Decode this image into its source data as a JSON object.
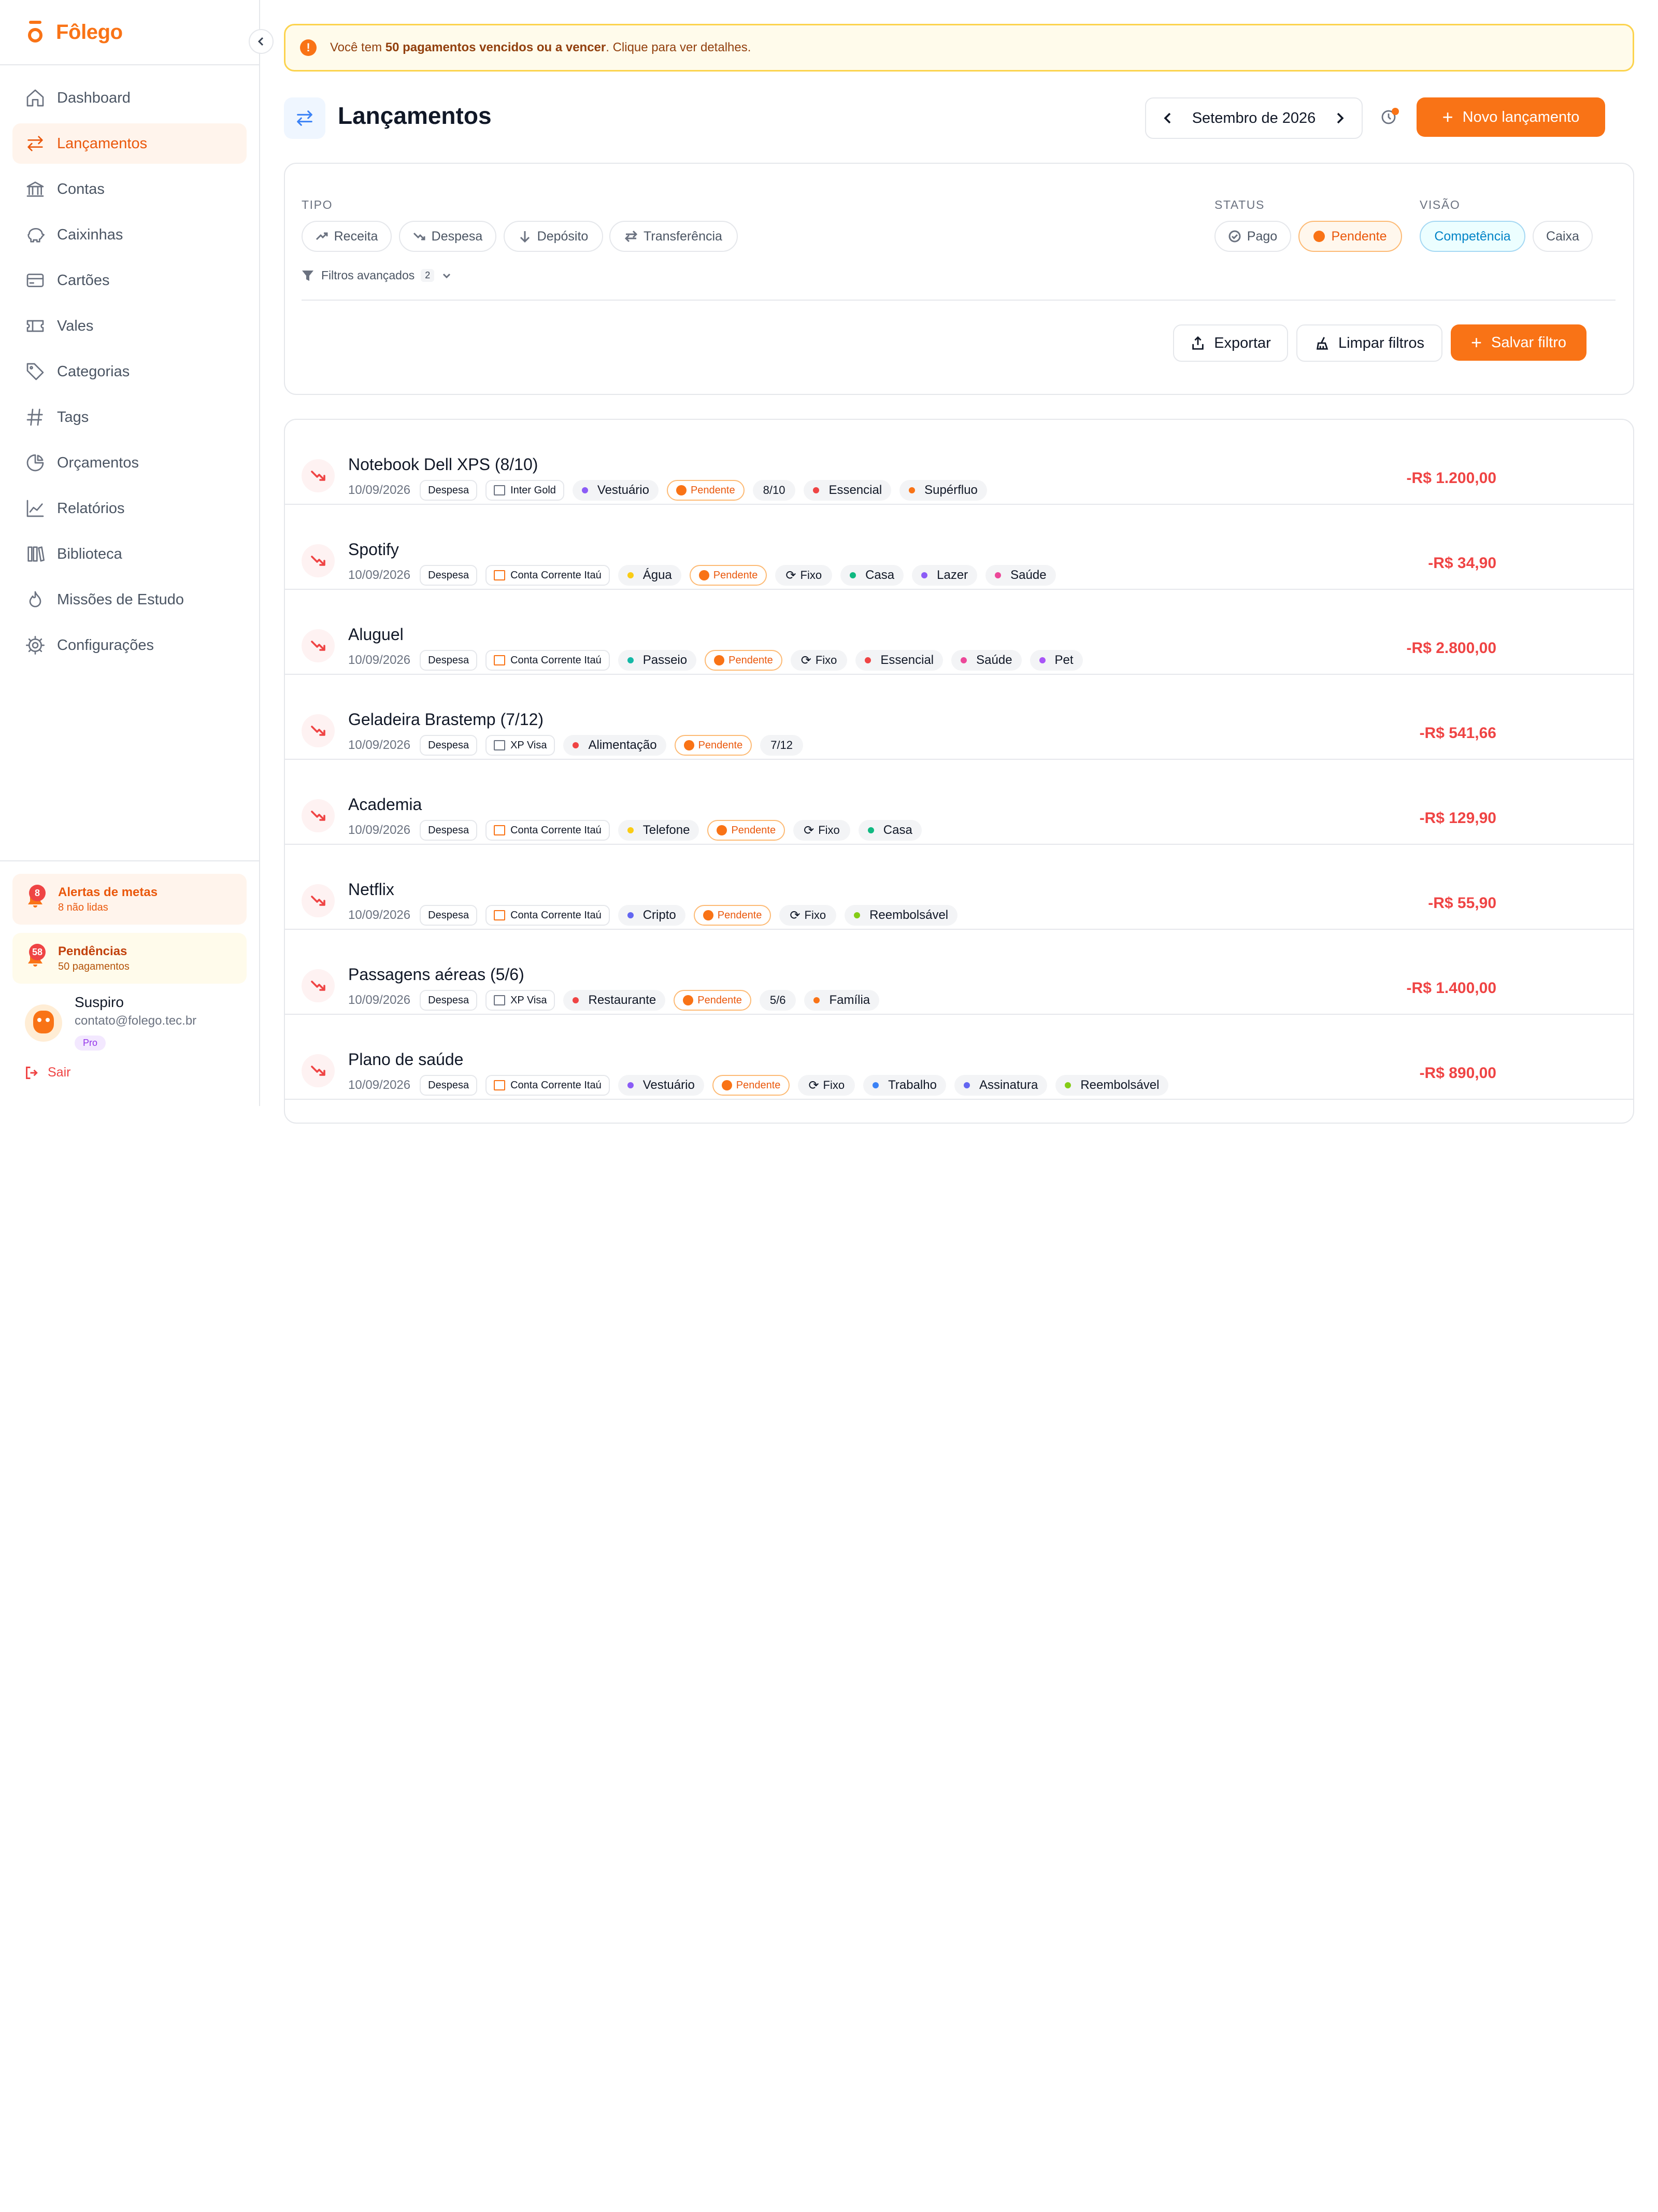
{
  "app": {
    "name": "Fôlego"
  },
  "sidebar": {
    "items": [
      {
        "label": "Dashboard",
        "icon": "home-icon"
      },
      {
        "label": "Lançamentos",
        "icon": "transfer-icon",
        "active": true
      },
      {
        "label": "Contas",
        "icon": "bank-icon"
      },
      {
        "label": "Caixinhas",
        "icon": "piggy-bank-icon"
      },
      {
        "label": "Cartões",
        "icon": "credit-card-icon"
      },
      {
        "label": "Vales",
        "icon": "ticket-icon"
      },
      {
        "label": "Categorias",
        "icon": "tag-icon"
      },
      {
        "label": "Tags",
        "icon": "hash-icon"
      },
      {
        "label": "Orçamentos",
        "icon": "pie-chart-icon"
      },
      {
        "label": "Relatórios",
        "icon": "line-chart-icon"
      },
      {
        "label": "Biblioteca",
        "icon": "library-icon"
      },
      {
        "label": "Missões de Estudo",
        "icon": "flame-icon"
      },
      {
        "label": "Configurações",
        "icon": "gear-icon"
      }
    ],
    "alerts": {
      "metas": {
        "title": "Alertas de metas",
        "sub": "8 não lidas",
        "count": "8"
      },
      "pendencias": {
        "title": "Pendências",
        "sub": "50 pagamentos",
        "count": "58"
      }
    },
    "user": {
      "name": "Suspiro",
      "email": "contato@folego.tec.br",
      "plan": "Pro"
    },
    "logout": "Sair"
  },
  "banner": {
    "prefix": "Você tem ",
    "bold": "50 pagamentos vencidos ou a vencer",
    "suffix": ". Clique para ver detalhes."
  },
  "header": {
    "title": "Lançamentos",
    "month": "Setembro de 2026",
    "new_button": "Novo lançamento"
  },
  "filters": {
    "tipo_label": "TIPO",
    "tipo": [
      "Receita",
      "Despesa",
      "Depósito",
      "Transferência"
    ],
    "status_label": "STATUS",
    "status": [
      "Pago",
      "Pendente"
    ],
    "visao_label": "VISÃO",
    "visao": [
      "Competência",
      "Caixa"
    ],
    "advanced": "Filtros avançados",
    "advanced_count": "2",
    "export": "Exportar",
    "clear": "Limpar filtros",
    "save": "Salvar filtro"
  },
  "colors": {
    "accent": "#f97316",
    "danger": "#ef4444",
    "cat_purple": "#8b5cf6",
    "cat_red": "#ef4444",
    "cat_orange": "#f97316",
    "cat_yellow": "#facc15",
    "cat_green": "#10b981",
    "cat_pink": "#ec4899",
    "cat_blue": "#3b82f6",
    "cat_teal": "#14b8a6",
    "cat_lime": "#84cc16"
  },
  "transactions": [
    {
      "title": "Notebook Dell XPS (8/10)",
      "date": "10/09/2026",
      "type": "Despesa",
      "account": "Inter Gold",
      "account_icon": "credit-card-icon",
      "amount": "-R$ 1.200,00",
      "tags": [
        {
          "kind": "cat",
          "label": "Vestuário",
          "color": "#8b5cf6"
        },
        {
          "kind": "pend",
          "label": "Pendente"
        },
        {
          "kind": "plain",
          "label": "8/10"
        },
        {
          "kind": "cat",
          "label": "Essencial",
          "color": "#ef4444"
        },
        {
          "kind": "cat",
          "label": "Supérfluo",
          "color": "#f97316"
        }
      ]
    },
    {
      "title": "Spotify",
      "date": "10/09/2026",
      "type": "Despesa",
      "account": "Conta Corrente Itaú",
      "account_icon": "bank-icon",
      "amount": "-R$ 34,90",
      "tags": [
        {
          "kind": "cat",
          "label": "Água",
          "color": "#facc15"
        },
        {
          "kind": "pend",
          "label": "Pendente"
        },
        {
          "kind": "plain",
          "label": "Fixo",
          "refresh": true
        },
        {
          "kind": "cat",
          "label": "Casa",
          "color": "#10b981"
        },
        {
          "kind": "cat",
          "label": "Lazer",
          "color": "#8b5cf6"
        },
        {
          "kind": "cat",
          "label": "Saúde",
          "color": "#ec4899"
        }
      ]
    },
    {
      "title": "Aluguel",
      "date": "10/09/2026",
      "type": "Despesa",
      "account": "Conta Corrente Itaú",
      "account_icon": "bank-icon",
      "amount": "-R$ 2.800,00",
      "tags": [
        {
          "kind": "cat",
          "label": "Passeio",
          "color": "#14b8a6"
        },
        {
          "kind": "pend",
          "label": "Pendente"
        },
        {
          "kind": "plain",
          "label": "Fixo",
          "refresh": true
        },
        {
          "kind": "cat",
          "label": "Essencial",
          "color": "#ef4444"
        },
        {
          "kind": "cat",
          "label": "Saúde",
          "color": "#ec4899"
        },
        {
          "kind": "cat",
          "label": "Pet",
          "color": "#a855f7"
        }
      ]
    },
    {
      "title": "Geladeira Brastemp (7/12)",
      "date": "10/09/2026",
      "type": "Despesa",
      "account": "XP Visa",
      "account_icon": "credit-card-icon",
      "amount": "-R$ 541,66",
      "tags": [
        {
          "kind": "cat",
          "label": "Alimentação",
          "color": "#ef4444"
        },
        {
          "kind": "pend",
          "label": "Pendente"
        },
        {
          "kind": "plain",
          "label": "7/12"
        }
      ]
    },
    {
      "title": "Academia",
      "date": "10/09/2026",
      "type": "Despesa",
      "account": "Conta Corrente Itaú",
      "account_icon": "bank-icon",
      "amount": "-R$ 129,90",
      "tags": [
        {
          "kind": "cat",
          "label": "Telefone",
          "color": "#facc15"
        },
        {
          "kind": "pend",
          "label": "Pendente"
        },
        {
          "kind": "plain",
          "label": "Fixo",
          "refresh": true
        },
        {
          "kind": "cat",
          "label": "Casa",
          "color": "#10b981"
        }
      ]
    },
    {
      "title": "Netflix",
      "date": "10/09/2026",
      "type": "Despesa",
      "account": "Conta Corrente Itaú",
      "account_icon": "bank-icon",
      "amount": "-R$ 55,90",
      "tags": [
        {
          "kind": "cat",
          "label": "Cripto",
          "color": "#6366f1"
        },
        {
          "kind": "pend",
          "label": "Pendente"
        },
        {
          "kind": "plain",
          "label": "Fixo",
          "refresh": true
        },
        {
          "kind": "cat",
          "label": "Reembolsável",
          "color": "#84cc16"
        }
      ]
    },
    {
      "title": "Passagens aéreas (5/6)",
      "date": "10/09/2026",
      "type": "Despesa",
      "account": "XP Visa",
      "account_icon": "credit-card-icon",
      "amount": "-R$ 1.400,00",
      "tags": [
        {
          "kind": "cat",
          "label": "Restaurante",
          "color": "#ef4444"
        },
        {
          "kind": "pend",
          "label": "Pendente"
        },
        {
          "kind": "plain",
          "label": "5/6"
        },
        {
          "kind": "cat",
          "label": "Família",
          "color": "#f97316"
        }
      ]
    },
    {
      "title": "Plano de saúde",
      "date": "10/09/2026",
      "type": "Despesa",
      "account": "Conta Corrente Itaú",
      "account_icon": "bank-icon",
      "amount": "-R$ 890,00",
      "tags": [
        {
          "kind": "cat",
          "label": "Vestuário",
          "color": "#8b5cf6"
        },
        {
          "kind": "pend",
          "label": "Pendente"
        },
        {
          "kind": "plain",
          "label": "Fixo",
          "refresh": true
        },
        {
          "kind": "cat",
          "label": "Trabalho",
          "color": "#3b82f6"
        },
        {
          "kind": "cat",
          "label": "Assinatura",
          "color": "#6366f1"
        },
        {
          "kind": "cat",
          "label": "Reembolsável",
          "color": "#84cc16"
        }
      ]
    }
  ]
}
